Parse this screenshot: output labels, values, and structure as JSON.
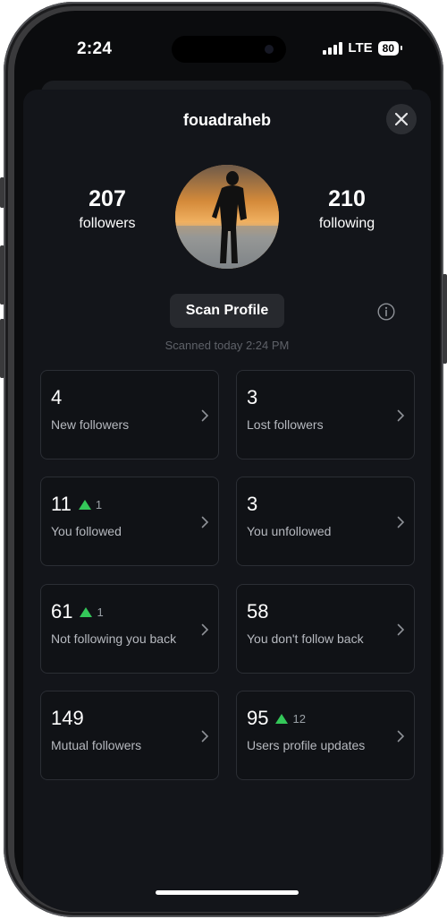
{
  "status_bar": {
    "time": "2:24",
    "network": "LTE",
    "battery": "80"
  },
  "profile": {
    "username": "fouadraheb",
    "followers_count": "207",
    "followers_label": "followers",
    "following_count": "210",
    "following_label": "following",
    "avatar_icon": "profile-photo-silhouette-sunset"
  },
  "actions": {
    "scan_label": "Scan Profile",
    "scanned_text": "Scanned today 2:24 PM",
    "info_icon": "info-icon",
    "close_icon": "close-icon"
  },
  "accent_colors": {
    "delta_up": "#34c759",
    "background": "#13151a",
    "card_border": "#2b2e34"
  },
  "cards": [
    {
      "value": "4",
      "delta": "",
      "label": "New followers"
    },
    {
      "value": "3",
      "delta": "",
      "label": "Lost followers"
    },
    {
      "value": "11",
      "delta": "1",
      "label": "You followed"
    },
    {
      "value": "3",
      "delta": "",
      "label": "You unfollowed"
    },
    {
      "value": "61",
      "delta": "1",
      "label": "Not following you back"
    },
    {
      "value": "58",
      "delta": "",
      "label": "You don't follow back"
    },
    {
      "value": "149",
      "delta": "",
      "label": "Mutual followers"
    },
    {
      "value": "95",
      "delta": "12",
      "label": "Users profile updates"
    }
  ]
}
